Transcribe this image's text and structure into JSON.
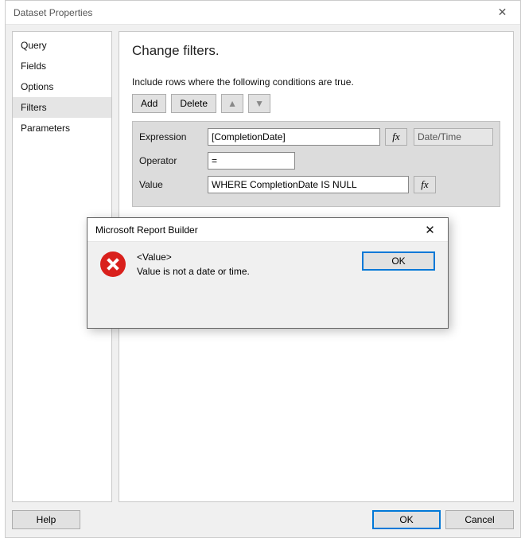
{
  "window": {
    "title": "Dataset Properties",
    "close_glyph": "✕"
  },
  "sidebar": {
    "items": [
      {
        "label": "Query",
        "selected": false
      },
      {
        "label": "Fields",
        "selected": false
      },
      {
        "label": "Options",
        "selected": false
      },
      {
        "label": "Filters",
        "selected": true
      },
      {
        "label": "Parameters",
        "selected": false
      }
    ]
  },
  "main": {
    "heading": "Change filters.",
    "instruction": "Include rows where the following conditions are true.",
    "buttons": {
      "add": "Add",
      "delete": "Delete",
      "up_glyph": "▲",
      "down_glyph": "▼"
    },
    "filter": {
      "expression_label": "Expression",
      "expression_value": "[CompletionDate]",
      "fx_label": "fx",
      "type_value": "Date/Time",
      "operator_label": "Operator",
      "operator_value": "=",
      "value_label": "Value",
      "value_value": "WHERE CompletionDate IS NULL"
    }
  },
  "footer": {
    "help": "Help",
    "ok": "OK",
    "cancel": "Cancel"
  },
  "modal": {
    "title": "Microsoft Report Builder",
    "close_glyph": "✕",
    "line1": "<Value>",
    "line2": "Value is not a date or time.",
    "ok": "OK"
  }
}
